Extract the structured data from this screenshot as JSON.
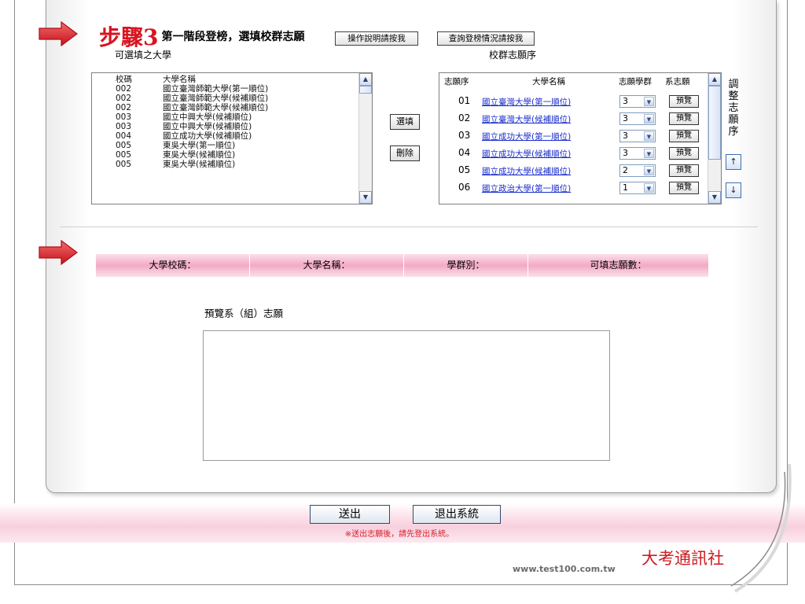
{
  "step": {
    "number": "步驟3",
    "title": "第一階段登榜，選填校群志願"
  },
  "top_buttons": {
    "instructions": "操作說明請按我",
    "query_status": "查詢登榜情況請按我"
  },
  "left_panel": {
    "label": "可選填之大學",
    "headers": {
      "code": "校碼",
      "name": "大學名稱"
    },
    "rows": [
      {
        "code": "002",
        "name": "國立臺灣師範大學(第一順位)"
      },
      {
        "code": "002",
        "name": "國立臺灣師範大學(候補順位)"
      },
      {
        "code": "002",
        "name": "國立臺灣師範大學(候補順位)"
      },
      {
        "code": "003",
        "name": "國立中興大學(候補順位)"
      },
      {
        "code": "003",
        "name": "國立中興大學(候補順位)"
      },
      {
        "code": "004",
        "name": "國立成功大學(候補順位)"
      },
      {
        "code": "005",
        "name": "東吳大學(第一順位)"
      },
      {
        "code": "005",
        "name": "東吳大學(候補順位)"
      },
      {
        "code": "005",
        "name": "東吳大學(候補順位)"
      }
    ]
  },
  "actions": {
    "select": "選填",
    "delete": "刪除"
  },
  "right_panel": {
    "label": "校群志願序",
    "headers": {
      "order": "志願序",
      "name": "大學名稱",
      "group": "志願學群",
      "dept": "系志願"
    },
    "preview_label": "預覽",
    "rows": [
      {
        "order": "01",
        "name": "國立臺灣大學(第一順位)",
        "group": "3"
      },
      {
        "order": "02",
        "name": "國立臺灣大學(候補順位)",
        "group": "3"
      },
      {
        "order": "03",
        "name": "國立成功大學(第一順位)",
        "group": "3"
      },
      {
        "order": "04",
        "name": "國立成功大學(候補順位)",
        "group": "3"
      },
      {
        "order": "05",
        "name": "國立成功大學(候補順位)",
        "group": "2"
      },
      {
        "order": "06",
        "name": "國立政治大學(第一順位)",
        "group": "1"
      }
    ]
  },
  "adjust": {
    "chars": [
      "調",
      "整",
      "志",
      "願",
      "序"
    ],
    "up": "↑",
    "down": "↓"
  },
  "info_bar": {
    "code": "大學校碼：",
    "name": "大學名稱：",
    "group": "學群別：",
    "count": "可填志願數："
  },
  "preview_title": "預覽系（組）志願",
  "bottom": {
    "submit": "送出",
    "exit": "退出系統",
    "note": "※送出志願後，請先登出系統。"
  },
  "footer": {
    "url": "www.test100.com.tw",
    "publisher": "大考通訊社"
  },
  "colors": {
    "accent_red": "#d9131f",
    "link_blue": "#1a2ccc",
    "pink": "#f3a9c5"
  }
}
